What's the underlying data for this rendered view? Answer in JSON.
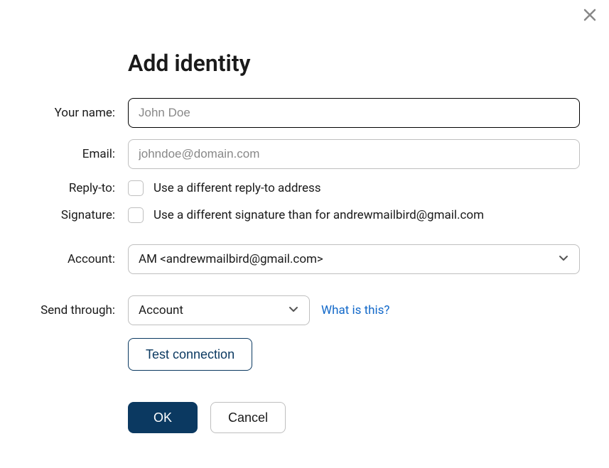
{
  "title": "Add identity",
  "labels": {
    "your_name": "Your name:",
    "email": "Email:",
    "reply_to": "Reply-to:",
    "signature": "Signature:",
    "account": "Account:",
    "send_through": "Send through:"
  },
  "inputs": {
    "your_name_placeholder": "John Doe",
    "your_name_value": "",
    "email_placeholder": "johndoe@domain.com",
    "email_value": ""
  },
  "checkboxes": {
    "reply_to_label": "Use a different reply-to address",
    "signature_label": "Use a different signature than for andrewmailbird@gmail.com"
  },
  "selects": {
    "account_value": "AM <andrewmailbird@gmail.com>",
    "send_through_value": "Account"
  },
  "links": {
    "what_is_this": "What is this?"
  },
  "buttons": {
    "test_connection": "Test connection",
    "ok": "OK",
    "cancel": "Cancel"
  }
}
